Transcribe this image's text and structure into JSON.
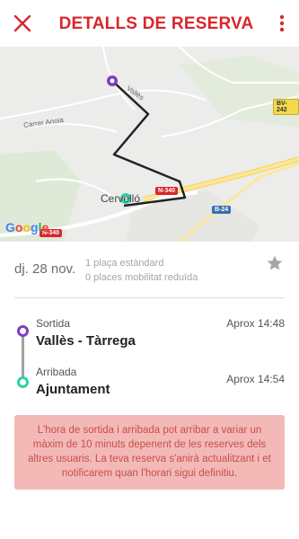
{
  "header": {
    "title": "DETALLS DE RESERVA",
    "close_icon": "close-icon",
    "menu_icon": "more-vert-icon",
    "accent_color": "#d9262c"
  },
  "map": {
    "labels": {
      "street_valles": "Vallès",
      "street_anoia": "Carrer Anoia",
      "town": "Cervelló",
      "road_n340_a": "N-340",
      "road_n340_b": "N-340",
      "road_b24": "B-24",
      "road_bv242": "BV-242"
    },
    "attribution": "Google",
    "origin_color": "#7b3fc4",
    "destination_color": "#2ed3a7"
  },
  "booking": {
    "date": "dj. 28 nov.",
    "seats_standard": "1 plaça estàndard",
    "seats_reduced_mobility": "0 places mobilitat reduïda",
    "favorite_icon": "star-icon"
  },
  "route": {
    "departure": {
      "label": "Sortida",
      "name": "Vallès - Tàrrega",
      "time": "Aprox 14:48"
    },
    "arrival": {
      "label": "Arribada",
      "name": "Ajuntament",
      "time": "Aprox 14:54"
    }
  },
  "notice": {
    "text": "L'hora de sortida i arribada pot arribar a variar un màxim de 10 minuts depenent de les reserves dels altres usuaris. La teva reserva s'anirà actualitzant i et notificarem quan l'horari sigui definitiu."
  }
}
